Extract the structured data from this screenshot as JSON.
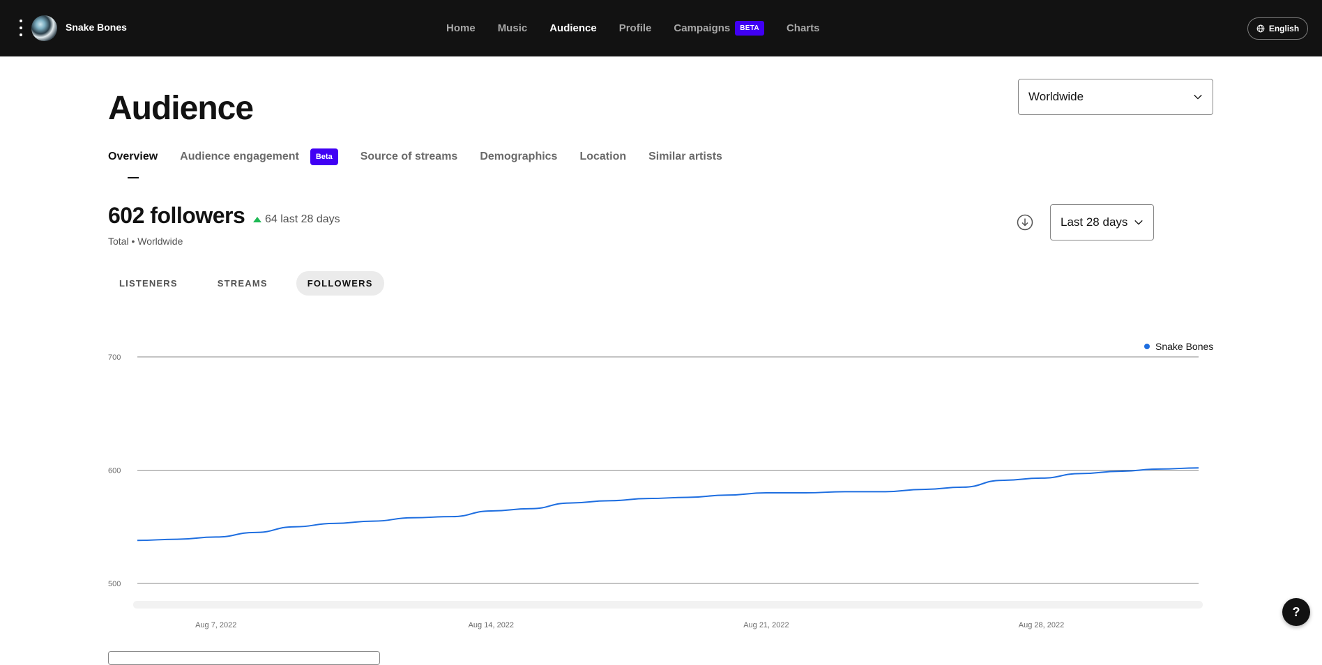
{
  "topbar": {
    "artist_name": "Snake Bones",
    "nav": [
      {
        "label": "Home",
        "active": false
      },
      {
        "label": "Music",
        "active": false
      },
      {
        "label": "Audience",
        "active": true
      },
      {
        "label": "Profile",
        "active": false
      },
      {
        "label": "Campaigns",
        "active": false,
        "badge": "BETA"
      },
      {
        "label": "Charts",
        "active": false
      }
    ],
    "language": "English"
  },
  "page": {
    "title": "Audience",
    "region": "Worldwide",
    "tabs": [
      {
        "label": "Overview",
        "active": true
      },
      {
        "label": "Audience engagement",
        "active": false,
        "badge": "Beta"
      },
      {
        "label": "Source of streams",
        "active": false
      },
      {
        "label": "Demographics",
        "active": false
      },
      {
        "label": "Location",
        "active": false
      },
      {
        "label": "Similar artists",
        "active": false
      }
    ]
  },
  "stats": {
    "headline": "602 followers",
    "delta": "64 last 28 days",
    "delta_direction": "up",
    "subtitle": "Total • Worldwide",
    "range": "Last 28 days"
  },
  "metric_tabs": [
    {
      "label": "LISTENERS",
      "active": false
    },
    {
      "label": "STREAMS",
      "active": false
    },
    {
      "label": "FOLLOWERS",
      "active": true
    }
  ],
  "colors": {
    "accent_purple": "#4000f4",
    "line_blue": "#1e6ee0",
    "up_green": "#1db954",
    "topbar_bg": "#121212"
  },
  "chart_data": {
    "type": "line",
    "xlabel": "",
    "ylabel": "",
    "ylim": [
      500,
      700
    ],
    "yticks": [
      700,
      600,
      500
    ],
    "grid": true,
    "legend_position": "top-right",
    "x_tick_labels": [
      "Aug 7, 2022",
      "Aug 14, 2022",
      "Aug 21, 2022",
      "Aug 28, 2022"
    ],
    "x": [
      "Aug 5, 2022",
      "Aug 6, 2022",
      "Aug 7, 2022",
      "Aug 8, 2022",
      "Aug 9, 2022",
      "Aug 10, 2022",
      "Aug 11, 2022",
      "Aug 12, 2022",
      "Aug 13, 2022",
      "Aug 14, 2022",
      "Aug 15, 2022",
      "Aug 16, 2022",
      "Aug 17, 2022",
      "Aug 18, 2022",
      "Aug 19, 2022",
      "Aug 20, 2022",
      "Aug 21, 2022",
      "Aug 22, 2022",
      "Aug 23, 2022",
      "Aug 24, 2022",
      "Aug 25, 2022",
      "Aug 26, 2022",
      "Aug 27, 2022",
      "Aug 28, 2022",
      "Aug 29, 2022",
      "Aug 30, 2022",
      "Aug 31, 2022",
      "Sep 1, 2022"
    ],
    "series": [
      {
        "name": "Snake Bones",
        "values": [
          538,
          539,
          541,
          545,
          550,
          553,
          555,
          558,
          559,
          564,
          566,
          571,
          573,
          575,
          576,
          578,
          580,
          580,
          581,
          581,
          583,
          585,
          591,
          593,
          597,
          599,
          601,
          602
        ]
      }
    ]
  },
  "help_label": "?"
}
